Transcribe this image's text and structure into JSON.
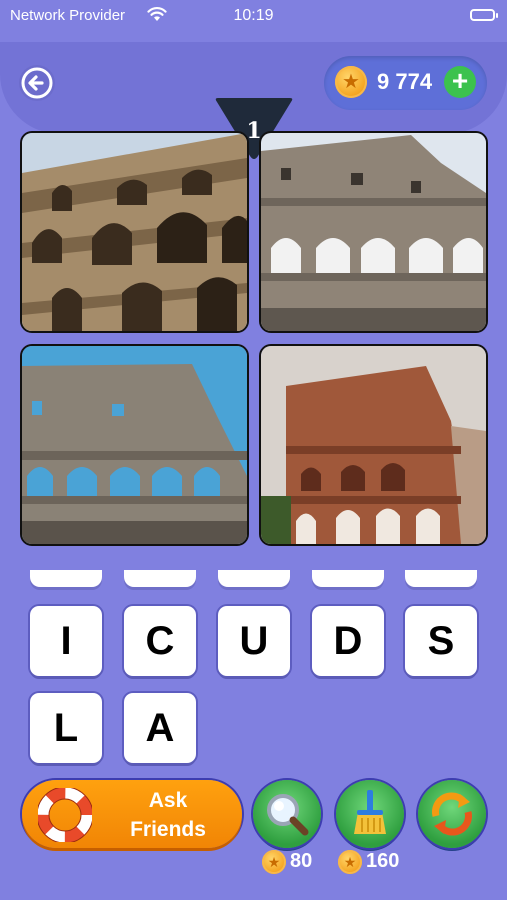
{
  "status": {
    "carrier": "Network Provider",
    "time": "10:19"
  },
  "header": {
    "coins": "9 774",
    "add_symbol": "+"
  },
  "level": {
    "number": "1"
  },
  "letters": [
    "I",
    "C",
    "U",
    "D",
    "S",
    "L",
    "A"
  ],
  "actions": {
    "ask_friends_line1": "Ask",
    "ask_friends_line2": "Friends",
    "reveal_cost": "80",
    "clear_cost": "160"
  },
  "icons": {
    "back": "back-arrow-icon",
    "coin": "coin-icon",
    "add": "plus-icon",
    "ask": "lifebuoy-icon",
    "reveal": "magnifier-icon",
    "clear": "broom-icon",
    "shuffle": "shuffle-icon"
  },
  "colors": {
    "background": "#8080e0",
    "orange": "#f39208",
    "green": "#3cc24e",
    "coin": "#f5a623"
  }
}
